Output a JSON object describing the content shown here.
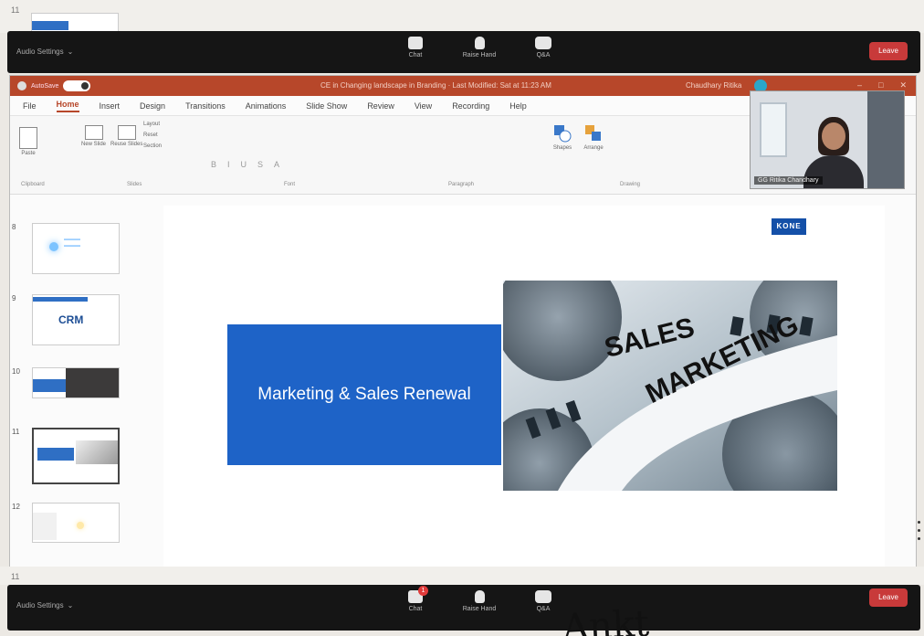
{
  "top_strip": {
    "slide_number": "11"
  },
  "zoom": {
    "audio_settings": "Audio Settings",
    "chat": "Chat",
    "raise_hand": "Raise Hand",
    "qa": "Q&A",
    "leave": "Leave",
    "chat_badge": "1"
  },
  "ppt": {
    "autosave": "AutoSave",
    "doc_title": "CE in Changing landscape in Branding · Last Modified: Sat at 11:23 AM",
    "user": "Chaudhary Ritika",
    "menu": [
      "File",
      "Home",
      "Insert",
      "Design",
      "Transitions",
      "Animations",
      "Slide Show",
      "Review",
      "View",
      "Recording",
      "Help"
    ],
    "ribbon": {
      "paste": "Paste",
      "new_slide": "New Slide",
      "reuse_slides": "Reuse Slides",
      "layout": "Layout",
      "reset": "Reset",
      "section": "Section",
      "clipboard": "Clipboard",
      "slides": "Slides",
      "font": "Font",
      "paragraph": "Paragraph",
      "shapes": "Shapes",
      "arrange": "Arrange",
      "drawing": "Drawing"
    },
    "video_name": "GG Ritika Chandhary"
  },
  "slides": [
    {
      "num": "8"
    },
    {
      "num": "9",
      "text": "CRM"
    },
    {
      "num": "10"
    },
    {
      "num": "11"
    },
    {
      "num": "12"
    }
  ],
  "main_slide": {
    "logo": "KONE",
    "title": "Marketing & Sales Renewal",
    "word_sales": "SALES",
    "word_marketing": "MARKETING"
  },
  "bottom_strip": {
    "slide_number": "11"
  },
  "handwriting": "Ankt"
}
